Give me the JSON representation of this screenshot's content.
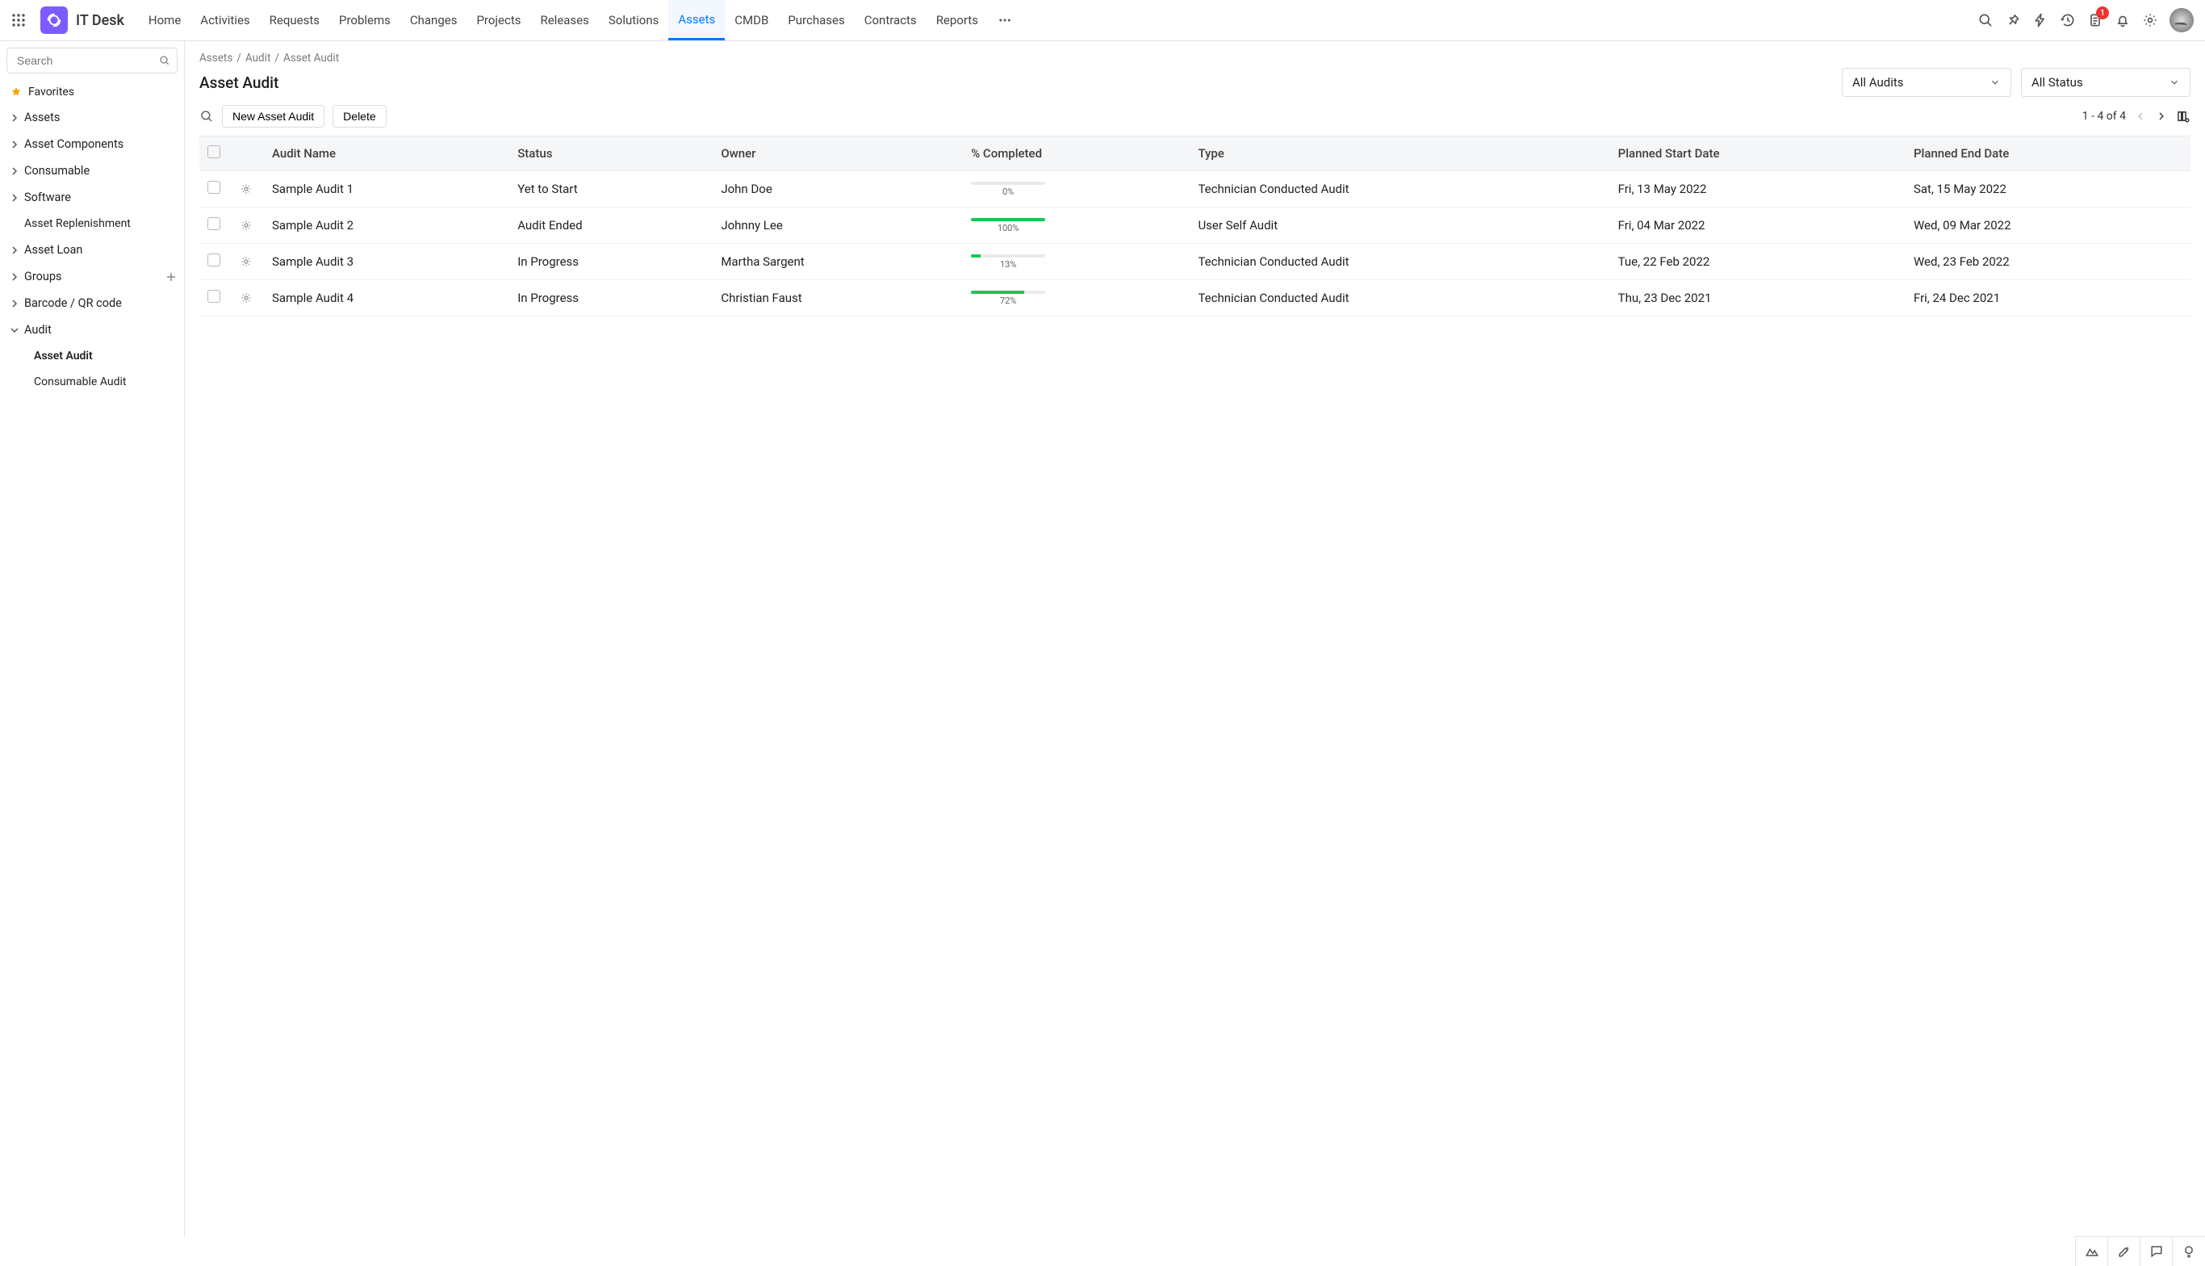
{
  "app_title": "IT Desk",
  "nav": [
    "Home",
    "Activities",
    "Requests",
    "Problems",
    "Changes",
    "Projects",
    "Releases",
    "Solutions",
    "Assets",
    "CMDB",
    "Purchases",
    "Contracts",
    "Reports"
  ],
  "nav_active_index": 8,
  "notification_badge": "1",
  "sidebar": {
    "search_placeholder": "Search",
    "favorites_label": "Favorites",
    "items": [
      {
        "label": "Assets",
        "expandable": true
      },
      {
        "label": "Asset Components",
        "expandable": true
      },
      {
        "label": "Consumable",
        "expandable": true
      },
      {
        "label": "Software",
        "expandable": true
      },
      {
        "label": "Asset Replenishment",
        "expandable": false,
        "indent": "sub"
      },
      {
        "label": "Asset Loan",
        "expandable": true
      },
      {
        "label": "Groups",
        "expandable": true,
        "add": true
      },
      {
        "label": "Barcode / QR code",
        "expandable": true
      },
      {
        "label": "Audit",
        "expandable": true,
        "expanded": true
      },
      {
        "label": "Asset Audit",
        "expandable": false,
        "indent": "sub2",
        "active": true
      },
      {
        "label": "Consumable Audit",
        "expandable": false,
        "indent": "sub2"
      }
    ]
  },
  "breadcrumb": [
    "Assets",
    "Audit",
    "Asset Audit"
  ],
  "page_title": "Asset Audit",
  "filter_audits": "All Audits",
  "filter_status": "All Status",
  "btn_new": "New Asset Audit",
  "btn_delete": "Delete",
  "pagination_text": "1 - 4 of 4",
  "columns": [
    "Audit Name",
    "Status",
    "Owner",
    "% Completed",
    "Type",
    "Planned Start Date",
    "Planned End Date"
  ],
  "rows": [
    {
      "name": "Sample Audit 1",
      "status": "Yet to Start",
      "owner": "John Doe",
      "pct": 0,
      "pct_text": "0%",
      "type": "Technician Conducted Audit",
      "start": "Fri, 13 May 2022",
      "end": "Sat, 15 May 2022"
    },
    {
      "name": "Sample Audit 2",
      "status": "Audit Ended",
      "owner": "Johnny Lee",
      "pct": 100,
      "pct_text": "100%",
      "type": "User Self Audit",
      "start": "Fri, 04 Mar 2022",
      "end": "Wed, 09 Mar 2022"
    },
    {
      "name": "Sample Audit 3",
      "status": "In Progress",
      "owner": "Martha Sargent",
      "pct": 13,
      "pct_text": "13%",
      "type": "Technician Conducted Audit",
      "start": "Tue, 22 Feb 2022",
      "end": "Wed, 23 Feb 2022"
    },
    {
      "name": "Sample Audit 4",
      "status": "In Progress",
      "owner": "Christian Faust",
      "pct": 72,
      "pct_text": "72%",
      "type": "Technician Conducted Audit",
      "start": "Thu, 23 Dec 2021",
      "end": "Fri, 24 Dec 2021"
    }
  ]
}
